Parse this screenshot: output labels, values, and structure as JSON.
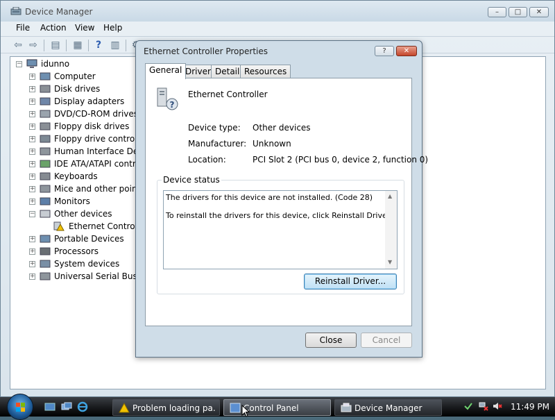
{
  "window": {
    "title": "Device Manager",
    "min_glyph": "–",
    "max_glyph": "□",
    "close_glyph": "✕"
  },
  "menu": [
    "File",
    "Action",
    "View",
    "Help"
  ],
  "tree": {
    "root": "idunno",
    "categories": [
      "Computer",
      "Disk drives",
      "Display adapters",
      "DVD/CD-ROM drives",
      "Floppy disk drives",
      "Floppy drive controllers",
      "Human Interface Devices",
      "IDE ATA/ATAPI controllers",
      "Keyboards",
      "Mice and other pointing devices",
      "Monitors",
      "Other devices",
      "Portable Devices",
      "Processors",
      "System devices",
      "Universal Serial Bus controllers"
    ],
    "other_device_child": "Ethernet Controller",
    "expand_glyph": "+",
    "collapse_glyph": "−"
  },
  "dialog": {
    "title": "Ethernet Controller Properties",
    "help_glyph": "?",
    "close_glyph": "✕",
    "tabs": [
      "General",
      "Driver",
      "Details",
      "Resources"
    ],
    "device_name": "Ethernet Controller",
    "device_type_label": "Device type:",
    "device_type_value": "Other devices",
    "manufacturer_label": "Manufacturer:",
    "manufacturer_value": "Unknown",
    "location_label": "Location:",
    "location_value": "PCI Slot 2 (PCI bus 0, device 2, function 0)",
    "status_group_label": "Device status",
    "status_line1": "The drivers for this device are not installed. (Code 28)",
    "status_line2": "To reinstall the drivers for this device, click Reinstall Driver.",
    "reinstall_button": "Reinstall Driver...",
    "close_button": "Close",
    "cancel_button": "Cancel"
  },
  "taskbar": {
    "tasks": [
      "Problem loading pa...",
      "Control Panel",
      "Device Manager"
    ],
    "clock": "11:49 PM"
  },
  "colors": {
    "accent": "#3c7fb1",
    "close_red": "#c4462b",
    "warning_yellow": "#f2c200"
  }
}
